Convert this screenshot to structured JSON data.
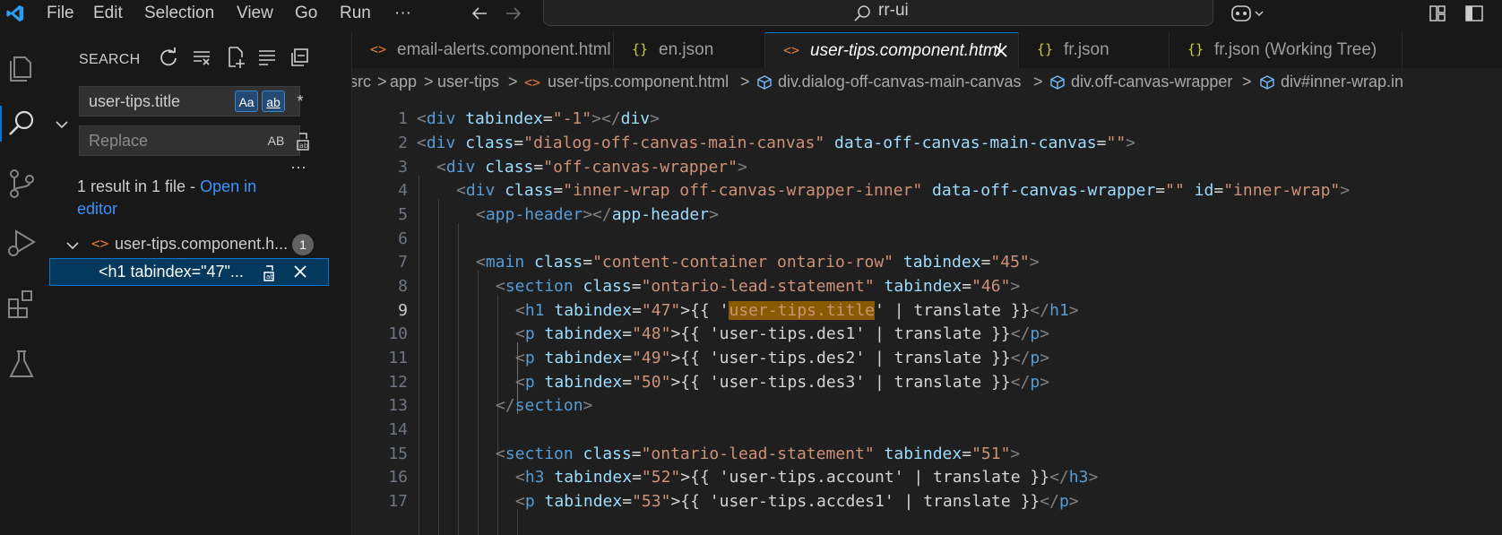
{
  "menu": [
    "File",
    "Edit",
    "Selection",
    "View",
    "Go",
    "Run",
    "···"
  ],
  "command_center": {
    "text": "rr-ui"
  },
  "sidebar": {
    "title": "SEARCH",
    "search_value": "user-tips.title",
    "replace_placeholder": "Replace",
    "options": [
      "Aa",
      "ab",
      "*"
    ],
    "replace_option": "AB",
    "more": "···",
    "results_summary": "1 result in 1 file - ",
    "open_in_editor_line1": "Open in",
    "open_in_editor_line2": "editor",
    "file_result": {
      "name": "user-tips.component.h...",
      "count": "1"
    },
    "match": "<h1 tabindex=\"47\"..."
  },
  "tabs": [
    {
      "icon": "<>",
      "label": "email-alerts.component.html",
      "active": false,
      "icon_color": "#e37933"
    },
    {
      "icon": "{}",
      "label": "en.json",
      "active": false,
      "icon_color": "#cbcb41"
    },
    {
      "icon": "<>",
      "label": "user-tips.component.html",
      "active": true,
      "icon_color": "#e37933"
    },
    {
      "icon": "{}",
      "label": "fr.json",
      "active": false,
      "icon_color": "#cbcb41"
    },
    {
      "icon": "{}",
      "label": "fr.json (Working Tree)",
      "active": false,
      "icon_color": "#cbcb41"
    }
  ],
  "breadcrumb": [
    "src",
    "app",
    "user-tips",
    "user-tips.component.html",
    "div.dialog-off-canvas-main-canvas",
    "div.off-canvas-wrapper",
    "div#inner-wrap.in"
  ],
  "code_lines": [
    {
      "n": "1"
    },
    {
      "n": "2"
    },
    {
      "n": "3"
    },
    {
      "n": "4"
    },
    {
      "n": "5"
    },
    {
      "n": "6"
    },
    {
      "n": "7"
    },
    {
      "n": "8"
    },
    {
      "n": "9"
    },
    {
      "n": "10"
    },
    {
      "n": "11"
    },
    {
      "n": "12"
    },
    {
      "n": "13"
    },
    {
      "n": "14"
    },
    {
      "n": "15"
    },
    {
      "n": "16"
    },
    {
      "n": "17"
    }
  ],
  "code_text": {
    "l1": [
      "<",
      "div",
      " ",
      "tabindex",
      "=",
      "\"-1\"",
      "></",
      "div",
      ">"
    ],
    "l2": [
      "<",
      "div",
      " ",
      "class",
      "=",
      "\"dialog-off-canvas-main-canvas\"",
      " ",
      "data-off-canvas-main-canvas",
      "=",
      "\"\"",
      ">"
    ],
    "l3": [
      "<",
      "div",
      " ",
      "class",
      "=",
      "\"off-canvas-wrapper\"",
      ">"
    ],
    "l4": [
      "<",
      "div",
      " ",
      "class",
      "=",
      "\"inner-wrap off-canvas-wrapper-inner\"",
      " ",
      "data-off-canvas-wrapper",
      "=",
      "\"\"",
      " ",
      "id",
      "=",
      "\"inner-wrap\"",
      ">"
    ],
    "l5": [
      "<",
      "app-header",
      "></",
      "app-header",
      ">"
    ],
    "l7": [
      "<",
      "main",
      " ",
      "class",
      "=",
      "\"content-container ontario-row\"",
      " ",
      "tabindex",
      "=",
      "\"45\"",
      ">"
    ],
    "l8": [
      "<",
      "section",
      " ",
      "class",
      "=",
      "\"ontario-lead-statement\"",
      " ",
      "tabindex",
      "=",
      "\"46\"",
      ">"
    ],
    "l9": [
      "<",
      "h1",
      " ",
      "tabindex",
      "=",
      "\"47\"",
      ">{{ '",
      "user-tips.title",
      "' | translate }}",
      "</",
      "h1",
      ">"
    ],
    "l10": [
      "<",
      "p",
      " ",
      "tabindex",
      "=",
      "\"48\"",
      ">{{ 'user-tips.des1' | translate }}",
      "</",
      "p",
      ">"
    ],
    "l11": [
      "<",
      "p",
      " ",
      "tabindex",
      "=",
      "\"49\"",
      ">{{ 'user-tips.des2' | translate }}",
      "</",
      "p",
      ">"
    ],
    "l12": [
      "<",
      "p",
      " ",
      "tabindex",
      "=",
      "\"50\"",
      ">{{ 'user-tips.des3' | translate }}",
      "</",
      "p",
      ">"
    ],
    "l13": [
      "</",
      "section",
      ">"
    ],
    "l15": [
      "<",
      "section",
      " ",
      "class",
      "=",
      "\"ontario-lead-statement\"",
      " ",
      "tabindex",
      "=",
      "\"51\"",
      ">"
    ],
    "l16": [
      "<",
      "h3",
      " ",
      "tabindex",
      "=",
      "\"52\"",
      ">{{ 'user-tips.account' | translate }}",
      "</",
      "h3",
      ">"
    ],
    "l17": [
      "<",
      "p",
      " ",
      "tabindex",
      "=",
      "\"53\"",
      ">{{ 'user-tips.accdes1' | translate }}",
      "</",
      "p",
      ">"
    ]
  }
}
